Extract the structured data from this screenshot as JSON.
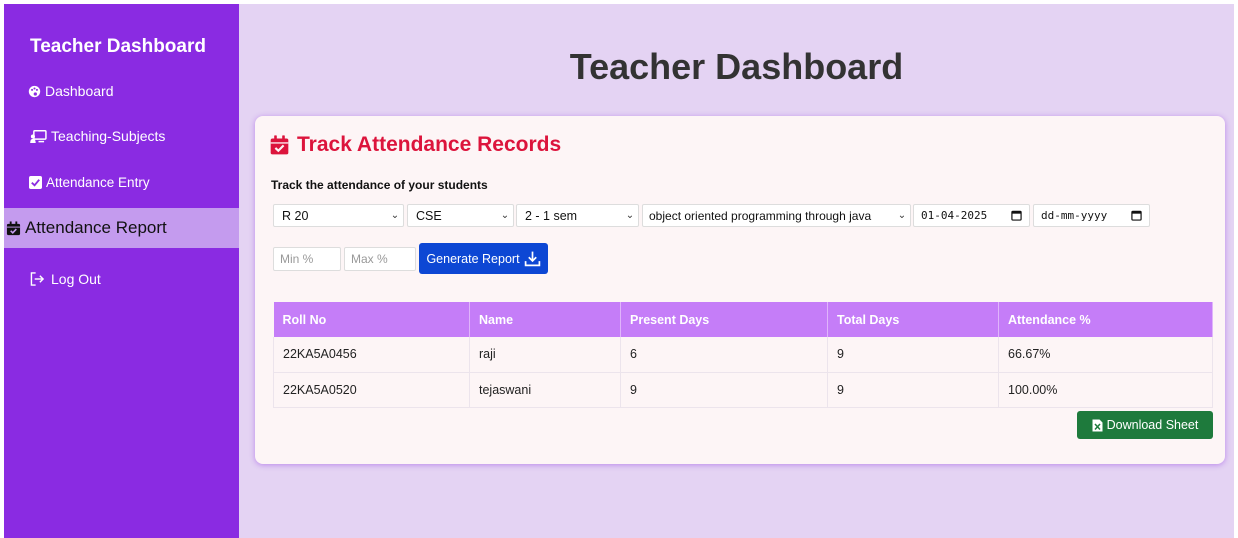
{
  "sidebar": {
    "title": "Teacher Dashboard",
    "items": [
      {
        "label": "Dashboard",
        "icon": "palette-icon"
      },
      {
        "label": "Teaching-Subjects",
        "icon": "chalkboard-teacher-icon"
      },
      {
        "label": "Attendance Entry",
        "icon": "check-square-icon"
      },
      {
        "label": "Attendance Report",
        "icon": "calendar-check-icon",
        "active": true
      },
      {
        "label": "Log Out",
        "icon": "logout-icon"
      }
    ]
  },
  "header": {
    "title": "Teacher Dashboard"
  },
  "report": {
    "title": "Track Attendance Records",
    "subtitle": "Track the attendance of your students",
    "filters": {
      "regulation": "R 20",
      "branch": "CSE",
      "semester": "2 - 1 sem",
      "subject": "object oriented programming through java",
      "from_date": "01-04-2025",
      "to_date": "dd-mm-yyyy"
    },
    "min_placeholder": "Min %",
    "max_placeholder": "Max %",
    "generate_label": "Generate Report",
    "download_label": "Download Sheet",
    "table": {
      "headers": [
        "Roll No",
        "Name",
        "Present Days",
        "Total Days",
        "Attendance %"
      ],
      "rows": [
        [
          "22KA5A0456",
          "raji",
          "6",
          "9",
          "66.67%"
        ],
        [
          "22KA5A0520",
          "tejaswani",
          "9",
          "9",
          "100.00%"
        ]
      ]
    }
  },
  "colors": {
    "sidebar": "#8a2be2",
    "active_item": "#c49bee",
    "background": "#e4d3f3",
    "accent_red": "#dc143c",
    "table_header": "#c57df8",
    "generate_button": "#0d47d4",
    "download_button": "#1e7a3c"
  }
}
